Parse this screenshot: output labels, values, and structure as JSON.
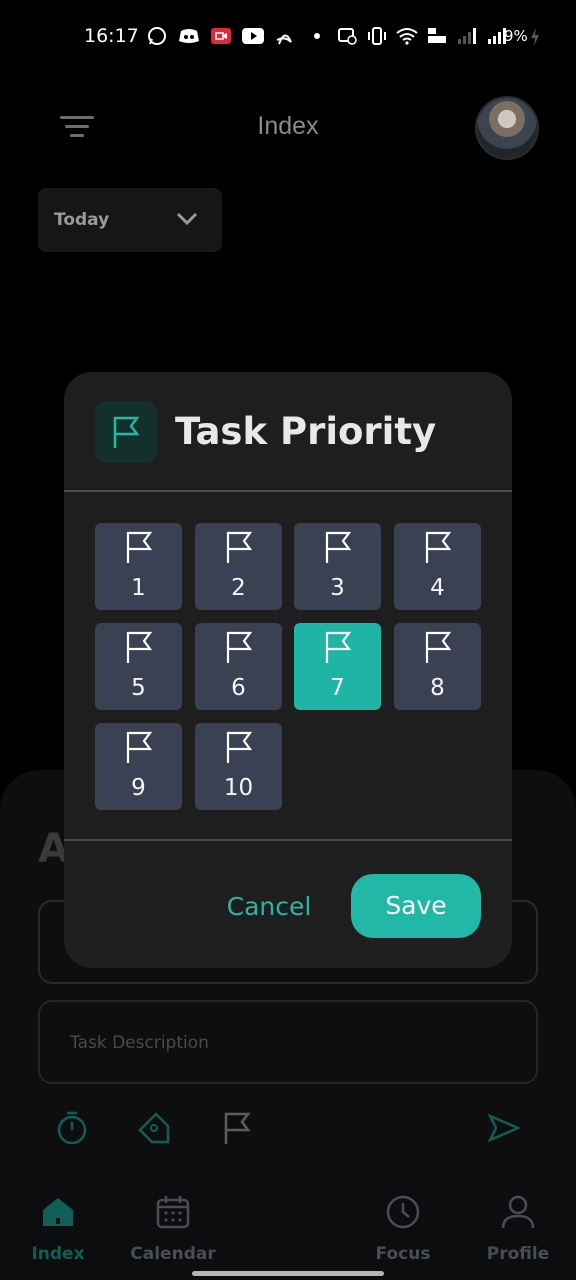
{
  "status_bar": {
    "time": "16:17",
    "battery": "9%"
  },
  "header": {
    "title": "Index"
  },
  "filter": {
    "selected": "Today"
  },
  "add_sheet": {
    "title_partial": "A",
    "description_placeholder": "Task Description"
  },
  "dialog": {
    "title": "Task Priority",
    "priorities": [
      "1",
      "2",
      "3",
      "4",
      "5",
      "6",
      "7",
      "8",
      "9",
      "10"
    ],
    "selected_priority": "7",
    "cancel_label": "Cancel",
    "save_label": "Save"
  },
  "bottom_nav": {
    "items": [
      {
        "label": "Index",
        "icon": "home-icon"
      },
      {
        "label": "Calendar",
        "icon": "calendar-icon"
      },
      {
        "label": "Focus",
        "icon": "clock-icon"
      },
      {
        "label": "Profile",
        "icon": "user-icon"
      }
    ]
  },
  "colors": {
    "accent": "#22b8a7",
    "priority_button": "#394152",
    "dialog_bg": "#1e1e1e"
  }
}
